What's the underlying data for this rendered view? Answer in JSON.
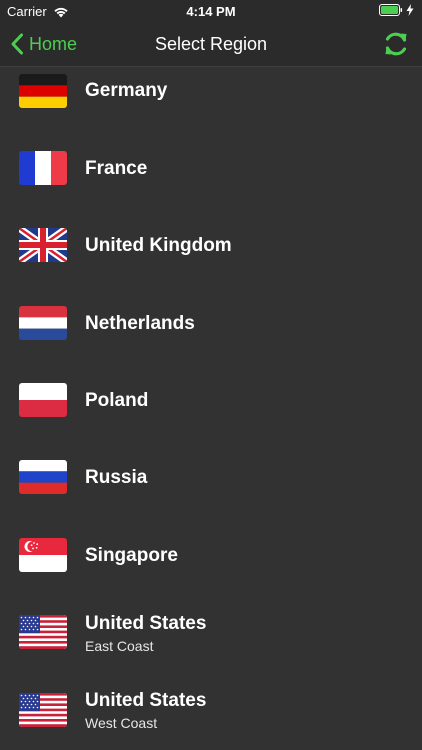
{
  "status_bar": {
    "carrier": "Carrier",
    "time": "4:14 PM",
    "icons": [
      "wifi-icon",
      "battery-icon",
      "charging-bolt-icon"
    ]
  },
  "nav": {
    "back_label": "Home",
    "title": "Select Region",
    "back_icon": "chevron-left-icon",
    "refresh_icon": "refresh-icon"
  },
  "colors": {
    "accent": "#4ccf50",
    "background": "#323232",
    "bar_background": "#2b2b2b"
  },
  "regions": [
    {
      "name": "Germany",
      "subtitle": "",
      "flag": "germany-flag-icon"
    },
    {
      "name": "France",
      "subtitle": "",
      "flag": "france-flag-icon"
    },
    {
      "name": "United Kingdom",
      "subtitle": "",
      "flag": "uk-flag-icon"
    },
    {
      "name": "Netherlands",
      "subtitle": "",
      "flag": "netherlands-flag-icon"
    },
    {
      "name": "Poland",
      "subtitle": "",
      "flag": "poland-flag-icon"
    },
    {
      "name": "Russia",
      "subtitle": "",
      "flag": "russia-flag-icon"
    },
    {
      "name": "Singapore",
      "subtitle": "",
      "flag": "singapore-flag-icon"
    },
    {
      "name": "United States",
      "subtitle": "East Coast",
      "flag": "us-flag-icon"
    },
    {
      "name": "United States",
      "subtitle": "West Coast",
      "flag": "us-flag-icon"
    }
  ]
}
